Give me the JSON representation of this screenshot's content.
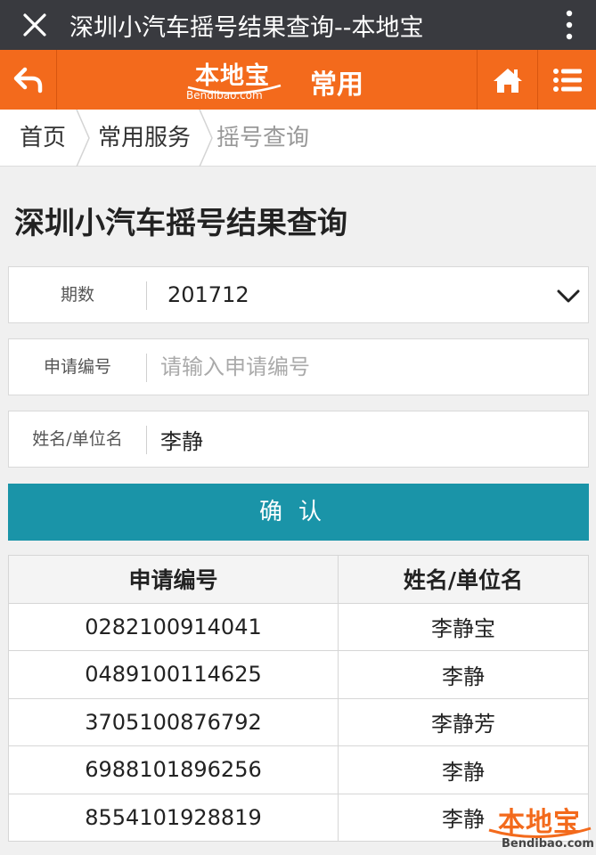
{
  "titlebar": {
    "close_icon": "close-icon",
    "title": "深圳小汽车摇号结果查询--本地宝",
    "more_icon": "more-vertical-icon"
  },
  "header": {
    "back_icon": "back-arrow-icon",
    "logo_cn": "本地宝",
    "logo_en": "Bendibao.com",
    "section": "常用",
    "home_icon": "home-icon",
    "menu_icon": "list-menu-icon",
    "accent": "#f36a1c"
  },
  "breadcrumb": [
    "首页",
    "常用服务",
    "摇号查询"
  ],
  "page": {
    "heading": "深圳小汽车摇号结果查询"
  },
  "form": {
    "period": {
      "label": "期数",
      "value": "201712"
    },
    "app_no": {
      "label": "申请编号",
      "placeholder": "请输入申请编号",
      "value": ""
    },
    "name": {
      "label": "姓名/单位名",
      "value": "李静"
    },
    "confirm_label": "确认",
    "confirm_color": "#1a94a8"
  },
  "results": {
    "headers": [
      "申请编号",
      "姓名/单位名"
    ],
    "rows": [
      [
        "0282100914041",
        "李静宝"
      ],
      [
        "0489100114625",
        "李静"
      ],
      [
        "3705100876792",
        "李静芳"
      ],
      [
        "6988101896256",
        "李静"
      ],
      [
        "8554101928819",
        "李静"
      ]
    ]
  },
  "watermark": {
    "cn": "本地宝",
    "en": "Bendibao.com"
  }
}
